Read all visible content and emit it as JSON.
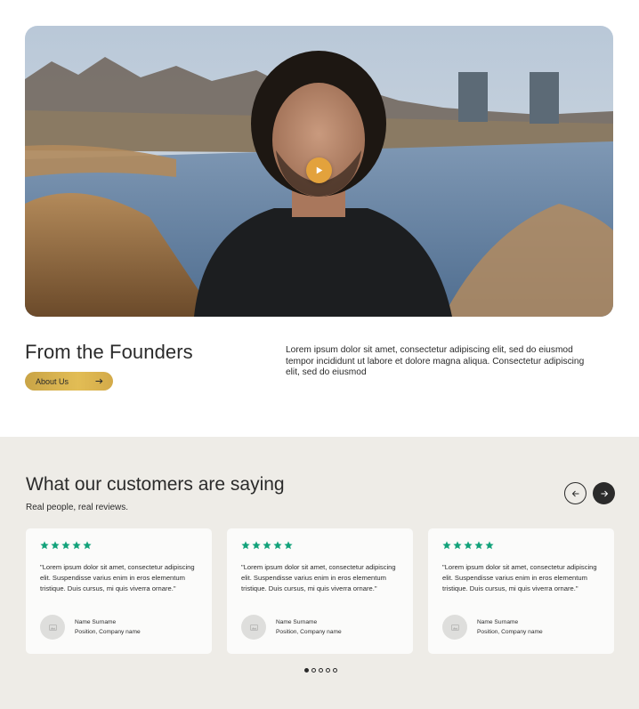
{
  "hero": {
    "play_icon": "play-icon"
  },
  "founders": {
    "title": "From the Founders",
    "button_label": "About Us",
    "button_icon": "arrow-right-icon",
    "text": "Lorem ipsum dolor sit amet, consectetur adipiscing elit, sed do eiusmod tempor incididunt ut labore et dolore magna aliqua. Consectetur adipiscing elit, sed do eiusmod"
  },
  "reviews": {
    "title": "What our customers are saying",
    "subtitle": "Real people, real reviews.",
    "prev_icon": "arrow-left-icon",
    "next_icon": "arrow-right-icon",
    "star_color": "#12a27a",
    "cards": [
      {
        "rating": 5,
        "quote": "\"Lorem ipsum dolor sit amet, consectetur adipiscing elit. Suspendisse varius enim in eros elementum tristique. Duis cursus, mi quis viverra ornare.\"",
        "name": "Name Surname",
        "position": "Position, Company name"
      },
      {
        "rating": 5,
        "quote": "\"Lorem ipsum dolor sit amet, consectetur adipiscing elit. Suspendisse varius enim in eros elementum tristique. Duis cursus, mi quis viverra ornare.\"",
        "name": "Name Surname",
        "position": "Position, Company name"
      },
      {
        "rating": 5,
        "quote": "\"Lorem ipsum dolor sit amet, consectetur adipiscing elit. Suspendisse varius enim in eros elementum tristique. Duis cursus, mi quis viverra ornare.\"",
        "name": "Name Surname",
        "position": "Position, Company name"
      }
    ],
    "pagination": {
      "total": 5,
      "active": 1
    }
  },
  "colors": {
    "accent_gold": "#d6ae4b",
    "play_button": "#e3a23c",
    "section_bg": "#eeece7",
    "dark": "#2b2b2b"
  }
}
